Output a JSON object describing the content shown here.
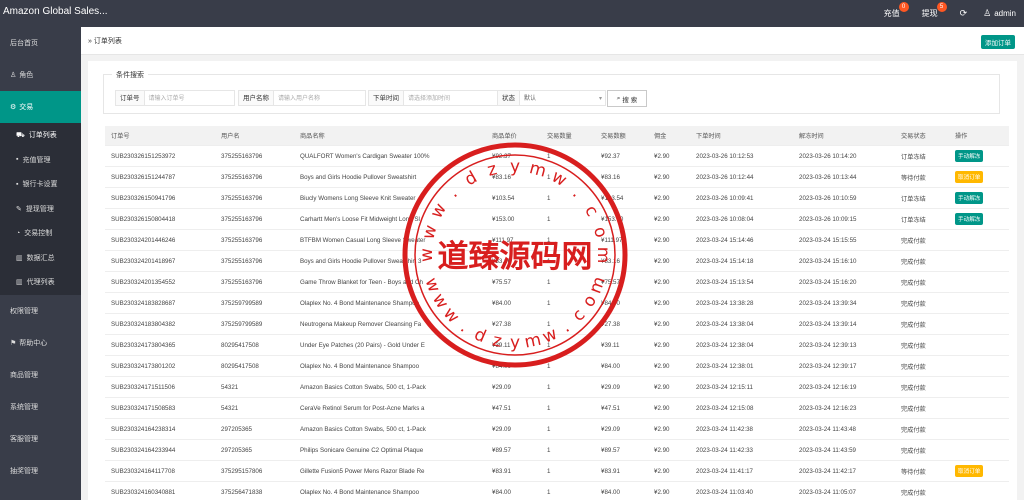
{
  "app": {
    "title": "Amazon Global Sales..."
  },
  "topbar": {
    "recharge": {
      "label": "充值",
      "badge": "0"
    },
    "withdraw": {
      "label": "提现",
      "badge": "5"
    },
    "user": "admin"
  },
  "sidebar": {
    "items": [
      {
        "label": "后台首页",
        "icon": "home-icon"
      },
      {
        "label": "角色",
        "icon": "user-icon"
      },
      {
        "label": "交易",
        "icon": "gear-icon",
        "active": true
      },
      {
        "label": "权限管理"
      },
      {
        "label": "帮助中心",
        "icon": "flag-icon"
      },
      {
        "label": "商品管理"
      },
      {
        "label": "系统管理"
      },
      {
        "label": "客服管理"
      },
      {
        "label": "抽奖管理"
      }
    ],
    "subitems": [
      {
        "label": "订单列表",
        "icon": "cart-icon",
        "current": true
      },
      {
        "label": "充值管理",
        "icon": "card-icon"
      },
      {
        "label": "银行卡设置",
        "icon": "card-icon"
      },
      {
        "label": "提现管理",
        "icon": "wrench-icon"
      },
      {
        "label": "交易控制",
        "icon": "dial-icon"
      },
      {
        "label": "数据汇总",
        "icon": "bar-chart-icon"
      },
      {
        "label": "代理列表",
        "icon": "bar-chart-icon"
      }
    ]
  },
  "breadcrumb": "订单列表",
  "add_order_label": "添加订单",
  "search": {
    "legend": "条件搜索",
    "order_no": {
      "label": "订单号",
      "placeholder": "请输入订单号"
    },
    "username": {
      "label": "用户名称",
      "placeholder": "请输入用户名称"
    },
    "order_time": {
      "label": "下单时间",
      "placeholder": "请选择添加时间"
    },
    "status": {
      "label": "状态",
      "value": "默认"
    },
    "button": "搜 索"
  },
  "table": {
    "columns": [
      "订单号",
      "用户名",
      "商品名称",
      "商品单价",
      "交易数量",
      "交易数额",
      "佣金",
      "下单时间",
      "解冻时间",
      "交易状态",
      "操作"
    ],
    "rows": [
      [
        "SUB230326151253972",
        "375255163796",
        "QUALFORT Women's Cardigan Sweater 100%",
        "¥92.37",
        "1",
        "¥92.37",
        "¥2.90",
        "2023-03-26 10:12:53",
        "2023-03-26 10:14:20",
        "订单冻结",
        "手动解冻"
      ],
      [
        "SUB230326151244787",
        "375255163796",
        "Boys and Girls Hoodie Pullover Sweatshirt",
        "¥83.16",
        "1",
        "¥83.16",
        "¥2.90",
        "2023-03-26 10:12:44",
        "2023-03-26 10:13:44",
        "等待付款",
        "取消订单"
      ],
      [
        "SUB230326150941796",
        "375255163796",
        "Biucly Womens Long Sleeve Knit Sweater",
        "¥103.54",
        "1",
        "¥103.54",
        "¥2.90",
        "2023-03-26 10:09:41",
        "2023-03-26 10:10:59",
        "订单冻结",
        "手动解冻"
      ],
      [
        "SUB230326150804418",
        "375255163796",
        "Carhartt Men's Loose Fit Midweight Long Sl",
        "¥153.00",
        "1",
        "¥153.00",
        "¥2.90",
        "2023-03-26 10:08:04",
        "2023-03-26 10:09:15",
        "订单冻结",
        "手动解冻"
      ],
      [
        "SUB230324201446246",
        "375255163796",
        "BTFBM Women Casual Long Sleeve Sweater",
        "¥111.97",
        "1",
        "¥111.97",
        "¥2.90",
        "2023-03-24 15:14:46",
        "2023-03-24 15:15:55",
        "完成付款",
        ""
      ],
      [
        "SUB230324201418967",
        "375255163796",
        "Boys and Girls Hoodie Pullover Sweatshirt 3",
        "¥83.16",
        "1",
        "¥83.16",
        "¥2.90",
        "2023-03-24 15:14:18",
        "2023-03-24 15:16:10",
        "完成付款",
        ""
      ],
      [
        "SUB230324201354552",
        "375255163796",
        "Game Throw Blanket for Teen - Boys and Ch",
        "¥75.57",
        "1",
        "¥75.57",
        "¥2.90",
        "2023-03-24 15:13:54",
        "2023-03-24 15:16:20",
        "完成付款",
        ""
      ],
      [
        "SUB230324183828687",
        "375259799589",
        "Olaplex No. 4 Bond Maintenance Shampoo",
        "¥84.00",
        "1",
        "¥84.00",
        "¥2.90",
        "2023-03-24 13:38:28",
        "2023-03-24 13:39:34",
        "完成付款",
        ""
      ],
      [
        "SUB230324183804382",
        "375259799589",
        "Neutrogena Makeup Remover Cleansing Fa",
        "¥27.38",
        "1",
        "¥27.38",
        "¥2.90",
        "2023-03-24 13:38:04",
        "2023-03-24 13:39:14",
        "完成付款",
        ""
      ],
      [
        "SUB230324173804365",
        "80295417508",
        "Under Eye Patches (20 Pairs) - Gold Under E",
        "¥39.11",
        "1",
        "¥39.11",
        "¥2.90",
        "2023-03-24 12:38:04",
        "2023-03-24 12:39:13",
        "完成付款",
        ""
      ],
      [
        "SUB230324173801202",
        "80295417508",
        "Olaplex No. 4 Bond Maintenance Shampoo",
        "¥84.00",
        "1",
        "¥84.00",
        "¥2.90",
        "2023-03-24 12:38:01",
        "2023-03-24 12:39:17",
        "完成付款",
        ""
      ],
      [
        "SUB230324171511506",
        "54321",
        "Amazon Basics Cotton Swabs, 500 ct, 1-Pack",
        "¥29.09",
        "1",
        "¥29.09",
        "¥2.90",
        "2023-03-24 12:15:11",
        "2023-03-24 12:16:19",
        "完成付款",
        ""
      ],
      [
        "SUB230324171508583",
        "54321",
        "CeraVe Retinol Serum for Post-Acne Marks a",
        "¥47.51",
        "1",
        "¥47.51",
        "¥2.90",
        "2023-03-24 12:15:08",
        "2023-03-24 12:16:23",
        "完成付款",
        ""
      ],
      [
        "SUB230324164238314",
        "297205365",
        "Amazon Basics Cotton Swabs, 500 ct, 1-Pack",
        "¥29.09",
        "1",
        "¥29.09",
        "¥2.90",
        "2023-03-24 11:42:38",
        "2023-03-24 11:43:48",
        "完成付款",
        ""
      ],
      [
        "SUB230324164233944",
        "297205365",
        "Philips Sonicare Genuine C2 Optimal Plaque",
        "¥89.57",
        "1",
        "¥89.57",
        "¥2.90",
        "2023-03-24 11:42:33",
        "2023-03-24 11:43:59",
        "完成付款",
        ""
      ],
      [
        "SUB230324164117708",
        "375295157806",
        "Gillette Fusion5 Power Mens Razor Blade Re",
        "¥83.91",
        "1",
        "¥83.91",
        "¥2.90",
        "2023-03-24 11:41:17",
        "2023-03-24 11:42:17",
        "等待付款",
        "取消订单"
      ],
      [
        "SUB230324160340881",
        "375256471838",
        "Olaplex No. 4 Bond Maintenance Shampoo",
        "¥84.00",
        "1",
        "¥84.00",
        "¥2.90",
        "2023-03-24 11:03:40",
        "2023-03-24 11:05:07",
        "完成付款",
        ""
      ]
    ]
  },
  "watermark": {
    "center_text": "道臻源码网",
    "ring_text": "www.dzymw.com"
  },
  "colors": {
    "topbar": "#393d49",
    "accent": "#009688",
    "warning": "#ffb800",
    "badge": "#ff5722",
    "stamp": "#d81e1e"
  }
}
